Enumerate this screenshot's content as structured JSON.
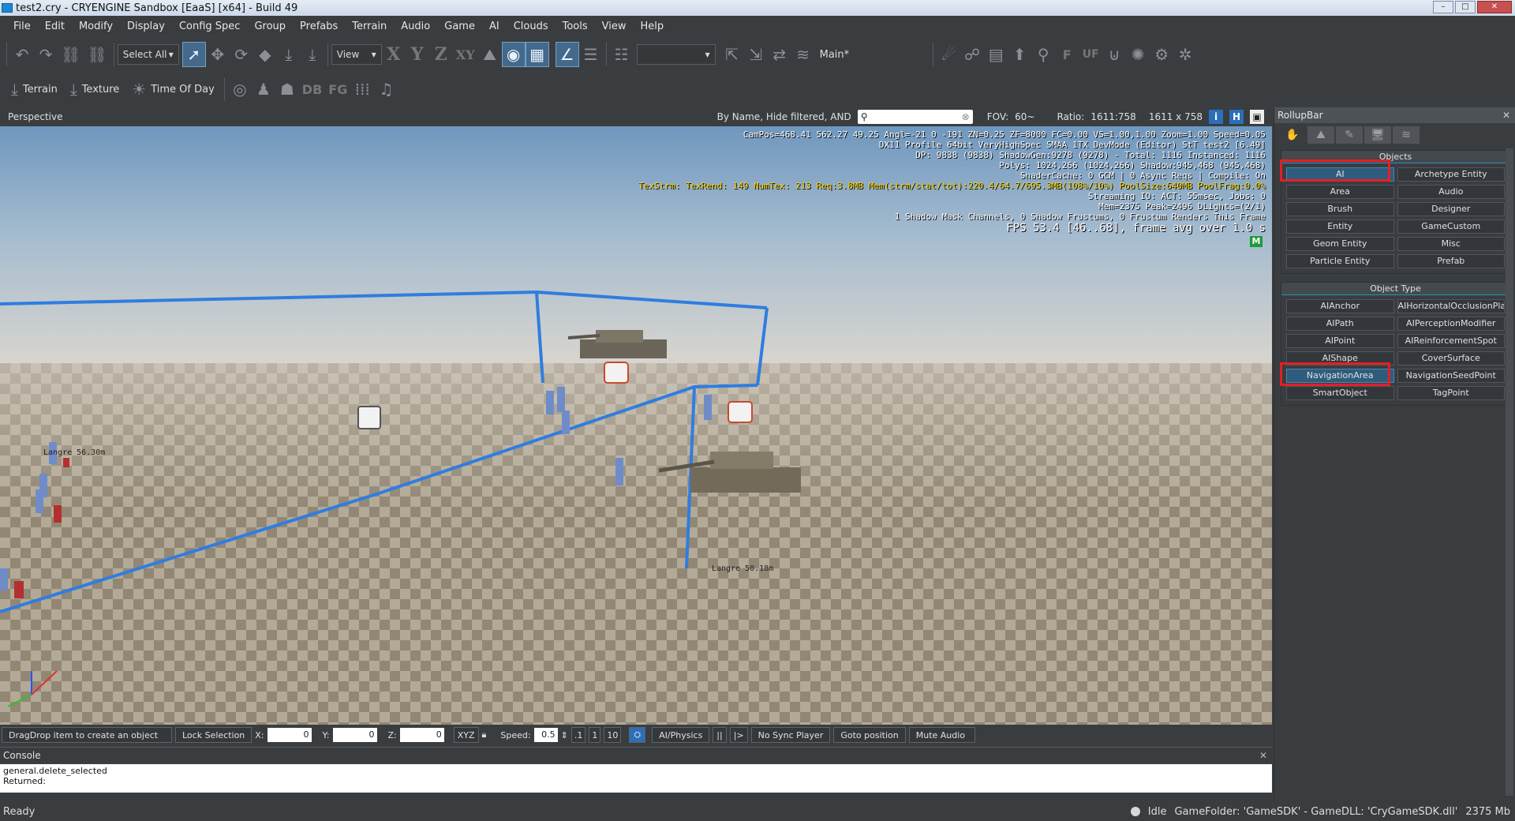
{
  "window": {
    "title": "test2.cry - CRYENGINE Sandbox [EaaS] [x64] - Build 49",
    "min": "–",
    "max": "□",
    "close": "✕"
  },
  "menu": [
    "File",
    "Edit",
    "Modify",
    "Display",
    "Config Spec",
    "Group",
    "Prefabs",
    "Terrain",
    "Audio",
    "Game",
    "AI",
    "Clouds",
    "Tools",
    "View",
    "Help"
  ],
  "toolbar": {
    "select_all": "Select All",
    "view": "View",
    "axis_x": "X",
    "axis_y": "Y",
    "axis_z": "Z",
    "axis_xy": "XY",
    "layer": "Main*",
    "f": "F",
    "uf": "UF",
    "db": "DB",
    "fg": "FG"
  },
  "toolbar2": {
    "terrain": "Terrain",
    "texture": "Texture",
    "time_of_day": "Time Of Day"
  },
  "viewport": {
    "title": "Perspective",
    "filter": "By Name, Hide filtered, AND",
    "fov_label": "FOV:",
    "fov": "60~",
    "ratio_label": "Ratio:",
    "ratio": "1611:758",
    "size": "1611 x 758",
    "btn_i": "i",
    "btn_h": "H",
    "label_range1": "Langre 56.30m",
    "label_range2": "Langre 50.18m"
  },
  "debug": {
    "line1": "CamPos=468.41 562.27 49.25 Angl=-21  0 -191 ZN=0.25 ZF=8000 FC=0.00 VS=1.00,1.00 Zoom=1.00 Speed=0.05",
    "line2": "DX11 Profile 64bit VeryHighSpec SMAA 1TX DevMode (Editor) StT test2 [6.49]",
    "line3": "DP: 9838 (9838) ShadowGen:9278 (9278) - Total: 1116 Instanced: 1116",
    "line4": "Polys: 1024,266 (1024,266) Shadow:945,468 (945,468)",
    "line5": "ShaderCache: 0 GCM | 0 Async Reqs | Compile: On",
    "line6": "TexStrm: TexRend: 149 NumTex: 213 Req:3.8MB Mem(strm/stat/tot):220.4/64.7/695.3MB(108%/10%) PoolSize:640MB PoolFrag:0.0%",
    "line7": "Streaming IO: ACT:  55msec, Jobs: 0",
    "line8": "Mem=2375 Peak=2496 DLights=(2/1)",
    "line9": "1 Shadow Mask Channels,   0 Shadow Frustums,   0 Frustum Renders This Frame",
    "line10": "FPS 53.4 [46..68], frame avg over 1.0 s",
    "badge": "M"
  },
  "status": {
    "dragdrop": "DragDrop item to create an object",
    "lock": "Lock Selection",
    "x_label": "X:",
    "x": "0",
    "y_label": "Y:",
    "y": "0",
    "z_label": "Z:",
    "z": "0",
    "xyz": "XYZ",
    "speed_label": "Speed:",
    "speed": "0.5",
    "s1": ".1",
    "s2": "1",
    "s3": "10",
    "aiphysics": "AI/Physics",
    "no_sync": "No Sync Player",
    "goto": "Goto position",
    "mute": "Mute Audio"
  },
  "console": {
    "title": "Console",
    "line1": "general.delete_selected",
    "line2": "Returned:"
  },
  "statusbar": {
    "ready": "Ready",
    "idle": "Idle",
    "gamefolder": "GameFolder: 'GameSDK' - GameDLL: 'CryGameSDK.dll'",
    "mem": "2375 Mb"
  },
  "rollup": {
    "title": "RollupBar",
    "objects_title": "Objects",
    "objects": [
      "AI",
      "Archetype Entity",
      "Area",
      "Audio",
      "Brush",
      "Designer",
      "Entity",
      "GameCustom",
      "Geom Entity",
      "Misc",
      "Particle Entity",
      "Prefab"
    ],
    "type_title": "Object Type",
    "types": [
      "AIAnchor",
      "AIHorizontalOcclusionPlane",
      "AIPath",
      "AIPerceptionModifier",
      "AIPoint",
      "AIReinforcementSpot",
      "AIShape",
      "CoverSurface",
      "NavigationArea",
      "NavigationSeedPoint",
      "SmartObject",
      "TagPoint"
    ]
  },
  "colors": {
    "accent": "#2a6fb7",
    "highlight": "#e21f27",
    "nav_line": "#2f7de0"
  }
}
